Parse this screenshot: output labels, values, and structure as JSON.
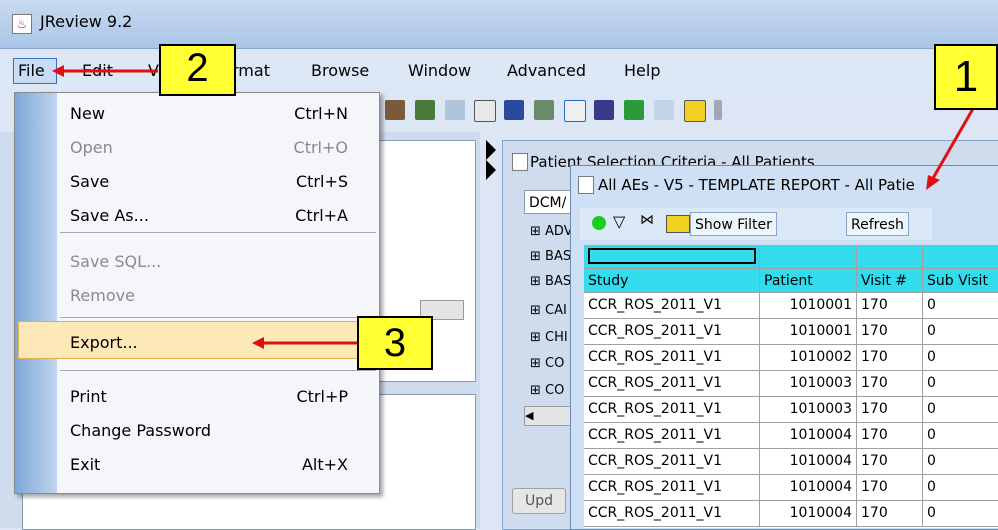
{
  "window": {
    "title": "JReview 9.2"
  },
  "menubar": {
    "items": [
      {
        "label": "File"
      },
      {
        "label": "Edit"
      },
      {
        "label": "View"
      },
      {
        "label": "Format"
      },
      {
        "label": "Browse"
      },
      {
        "label": "Window"
      },
      {
        "label": "Advanced"
      },
      {
        "label": "Help"
      }
    ],
    "visible": {
      "v_fragment": "V",
      "format_fragment": "rmat"
    }
  },
  "file_menu": {
    "items": [
      {
        "label": "New",
        "shortcut": "Ctrl+N",
        "enabled": true
      },
      {
        "label": "Open",
        "shortcut": "Ctrl+O",
        "enabled": false
      },
      {
        "label": "Save",
        "shortcut": "Ctrl+S",
        "enabled": true
      },
      {
        "label": "Save As...",
        "shortcut": "Ctrl+A",
        "enabled": true
      },
      {
        "label": "Save SQL...",
        "shortcut": "",
        "enabled": false
      },
      {
        "label": "Remove",
        "shortcut": "",
        "enabled": false
      },
      {
        "label": "Export...",
        "shortcut": "",
        "enabled": true
      },
      {
        "label": "Print",
        "shortcut": "Ctrl+P",
        "enabled": true
      },
      {
        "label": "Change Password",
        "shortcut": "",
        "enabled": true
      },
      {
        "label": "Exit",
        "shortcut": "Alt+X",
        "enabled": true
      }
    ]
  },
  "patient_window": {
    "title": "Patient Selection Criteria - All Patients",
    "tab_label": "DCM/",
    "tree_items": [
      "⊞ ADV",
      "⊞ BAS",
      "⊞ BAS",
      "⊞ CAI",
      "⊞ CHI",
      "⊞ CO",
      "⊞ CO"
    ],
    "update_button": "Upd"
  },
  "report_window": {
    "title": "All AEs - V5 - TEMPLATE REPORT - All Patie",
    "toolbar": {
      "show_filter": "Show Filter",
      "refresh": "Refresh"
    },
    "columns": [
      "Study",
      "Patient",
      "Visit #",
      "Sub Visit"
    ],
    "rows": [
      [
        "CCR_ROS_2011_V1",
        "1010001",
        "170",
        "0"
      ],
      [
        "CCR_ROS_2011_V1",
        "1010001",
        "170",
        "0"
      ],
      [
        "CCR_ROS_2011_V1",
        "1010002",
        "170",
        "0"
      ],
      [
        "CCR_ROS_2011_V1",
        "1010003",
        "170",
        "0"
      ],
      [
        "CCR_ROS_2011_V1",
        "1010003",
        "170",
        "0"
      ],
      [
        "CCR_ROS_2011_V1",
        "1010004",
        "170",
        "0"
      ],
      [
        "CCR_ROS_2011_V1",
        "1010004",
        "170",
        "0"
      ],
      [
        "CCR_ROS_2011_V1",
        "1010004",
        "170",
        "0"
      ],
      [
        "CCR_ROS_2011_V1",
        "1010004",
        "170",
        "0"
      ]
    ]
  },
  "annotations": {
    "one": "1",
    "two": "2",
    "three": "3"
  },
  "colors": {
    "accent_header": "#33dcec",
    "callout": "#ffff33",
    "arrow": "#e01010",
    "export_highlight": "#fde9b8"
  }
}
